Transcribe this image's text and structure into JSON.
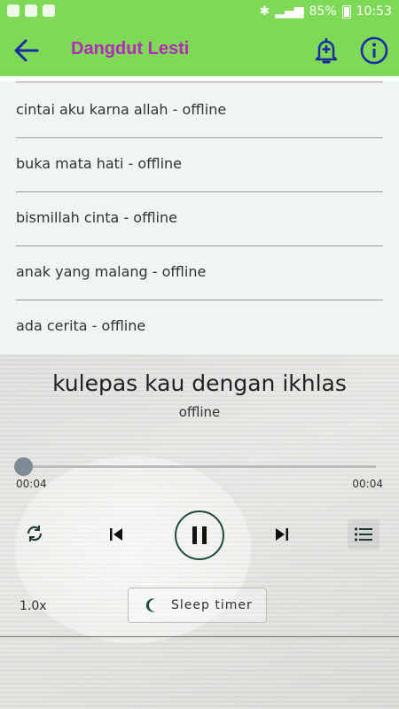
{
  "status_bar": {
    "battery": "85%",
    "time": "10:53"
  },
  "app_bar": {
    "title": "Dangdut Lesti"
  },
  "playlist": [
    {
      "label": "cintai aku karna allah - offline"
    },
    {
      "label": "buka mata hati - offline"
    },
    {
      "label": "bismillah cinta - offline"
    },
    {
      "label": "anak yang malang - offline"
    },
    {
      "label": "ada cerita - offline"
    }
  ],
  "player": {
    "now_playing": "kulepas kau dengan ikhlas",
    "source": "offline",
    "elapsed": "00:04",
    "duration": "00:04",
    "progress": 0.0,
    "speed": "1.0x",
    "sleep_timer_label": "Sleep timer"
  },
  "colors": {
    "appbar": "#7ed957",
    "title": "#b32bb8",
    "icons": "#1b2ba6",
    "play_ring": "#1f4c3a"
  }
}
